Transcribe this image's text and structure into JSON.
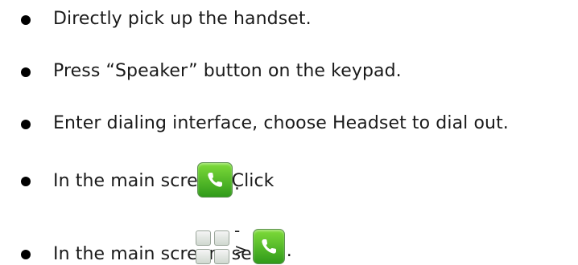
{
  "items": [
    {
      "text": "Directly pick up the handset."
    },
    {
      "text": "Press “Speaker” button on the keypad."
    },
    {
      "text": "Enter dialing interface, choose Headset to dial out."
    },
    {
      "text": "In the main screen, Click",
      "icon": "phone-icon",
      "suffix": "."
    },
    {
      "text": "In the main screen, select",
      "icon1": "menu-grid-icon",
      "arrow": "->",
      "icon2": "phone-icon",
      "suffix": "."
    }
  ],
  "colors": {
    "bullet": "#000000",
    "phone_icon_green": "#4caf2a"
  }
}
